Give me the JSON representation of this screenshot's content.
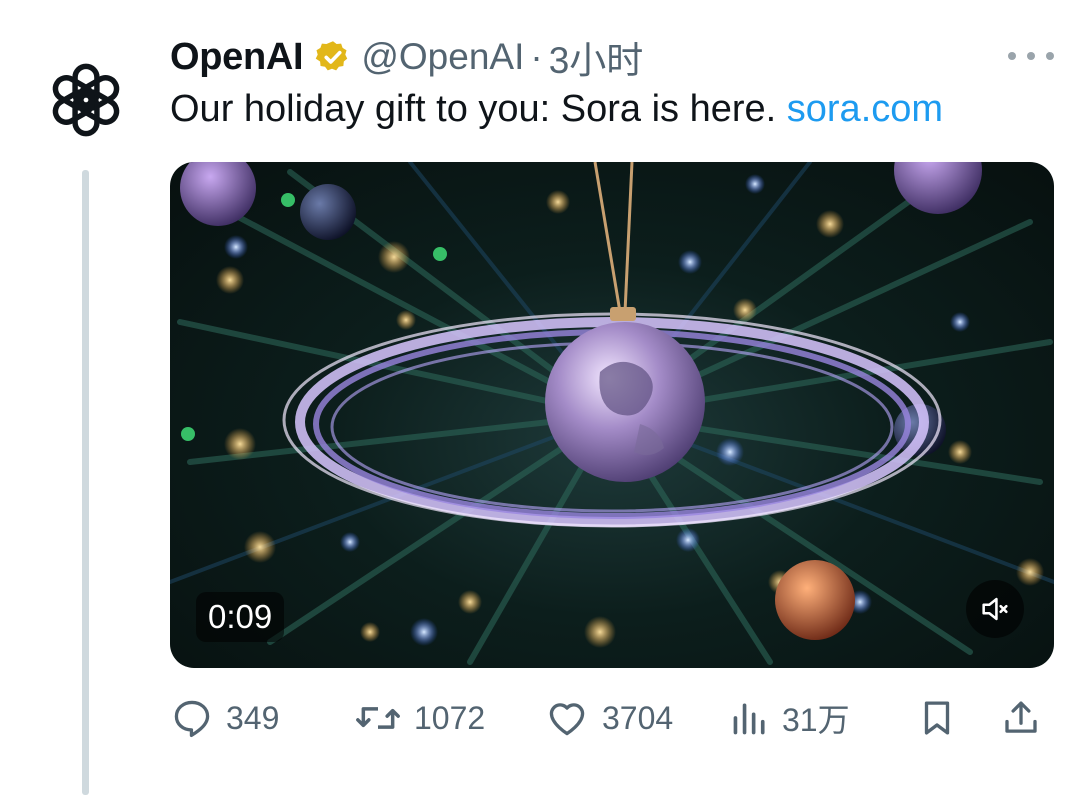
{
  "tweet": {
    "author_name": "OpenAI",
    "handle": "@OpenAI",
    "separator": "·",
    "time": "3小时",
    "text": "Our holiday gift to you: Sora is here. ",
    "link": "sora.com"
  },
  "media": {
    "type": "video",
    "duration": "0:09"
  },
  "actions": {
    "replies": "349",
    "retweets": "1072",
    "likes": "3704",
    "views": "31万"
  },
  "colors": {
    "link": "#1d9bf0",
    "secondary_text": "#536471",
    "verified_badge": "#e2b719",
    "thread_line": "#cfd9de"
  },
  "icons": [
    "openai-logo-icon",
    "verified-badge-icon",
    "more-icon",
    "mute-icon",
    "reply-icon",
    "retweet-icon",
    "like-icon",
    "views-icon",
    "bookmark-icon",
    "share-icon"
  ]
}
